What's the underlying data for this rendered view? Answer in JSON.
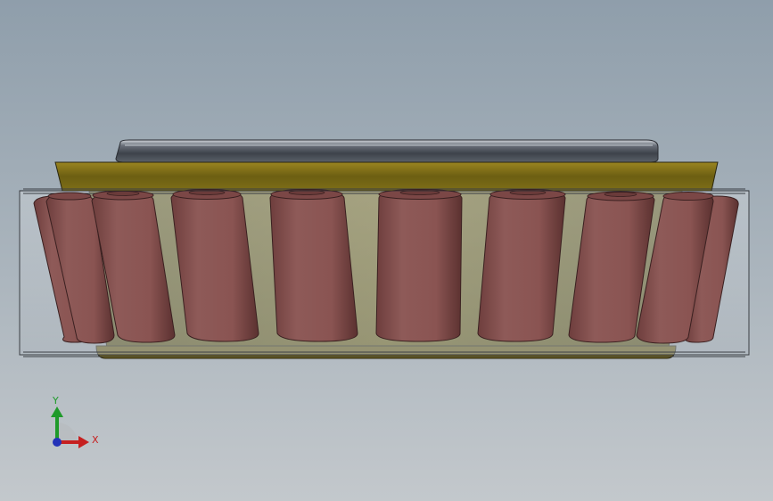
{
  "scene": {
    "name": "tapered-roller-bearing-front-view",
    "roller_count_visible": 10,
    "colors": {
      "background_top": "#8f9eab",
      "background_bottom": "#c3c8cc",
      "cage": "#7a6a12",
      "roller": "#8a5352",
      "inner_ring": "#4f555f",
      "outer_ring_glass": "#b9c0c6"
    }
  },
  "triad": {
    "y_label": "Y",
    "x_label": "X",
    "colors": {
      "x_axis": "#c62020",
      "y_axis": "#1f9a2a",
      "z_axis": "#2433b8"
    }
  }
}
